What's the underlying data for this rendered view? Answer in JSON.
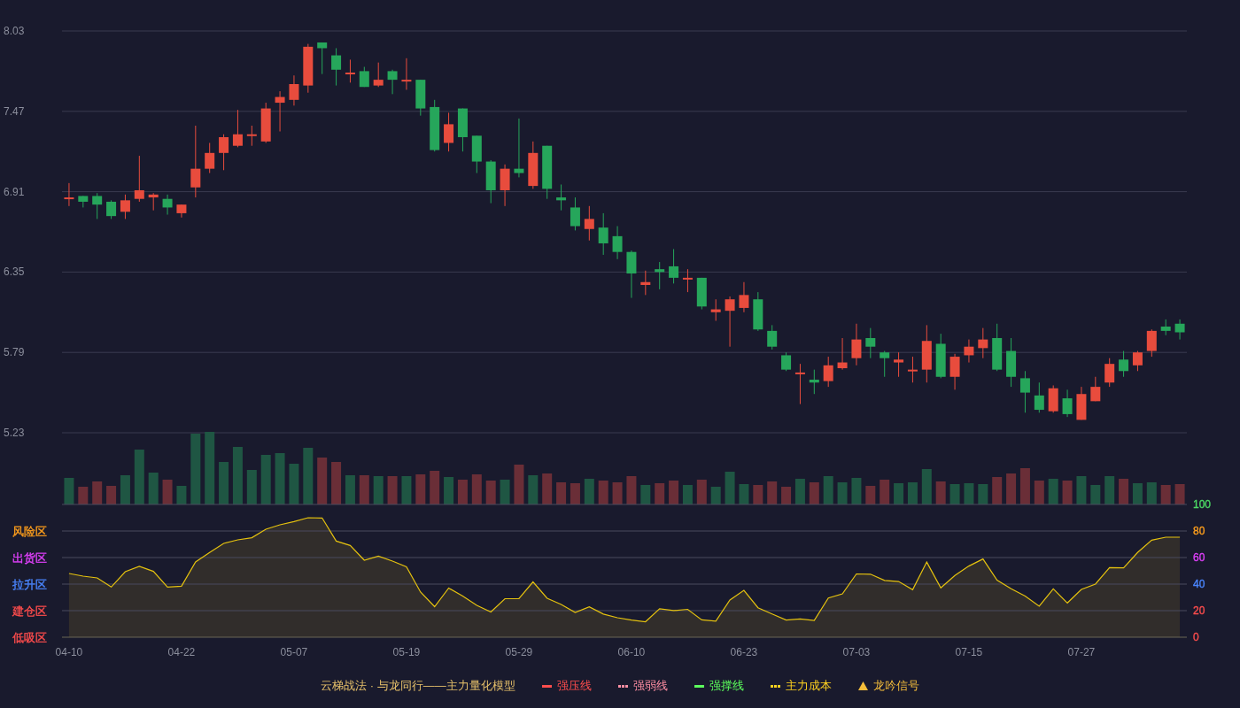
{
  "price_chart": {
    "chart_data": {
      "type": "candlestick",
      "categories": [
        null,
        null,
        null,
        null,
        null,
        null,
        null,
        null,
        null,
        null,
        null,
        null,
        null,
        null,
        null,
        null,
        null,
        null,
        null,
        null,
        null,
        null,
        null,
        null,
        null,
        null,
        null,
        null,
        null,
        null,
        null,
        null,
        null,
        null,
        null,
        null,
        null,
        null,
        null,
        null,
        null,
        null,
        null,
        null,
        null,
        null,
        null,
        null,
        null,
        null,
        null,
        null,
        null,
        null,
        null,
        null,
        null,
        null,
        null,
        null,
        null,
        null,
        null,
        null,
        null,
        null,
        null,
        null,
        null,
        null,
        null,
        null,
        null,
        null,
        null,
        null,
        null,
        null,
        null,
        null
      ],
      "ohlc": [
        [
          6.86,
          6.97,
          6.81,
          6.87
        ],
        [
          6.88,
          6.88,
          6.8,
          6.84
        ],
        [
          6.88,
          6.9,
          6.72,
          6.82
        ],
        [
          6.84,
          6.85,
          6.72,
          6.74
        ],
        [
          6.77,
          6.89,
          6.72,
          6.85
        ],
        [
          6.86,
          7.16,
          6.84,
          6.92
        ],
        [
          6.87,
          6.9,
          6.78,
          6.89
        ],
        [
          6.86,
          6.89,
          6.75,
          6.8
        ],
        [
          6.76,
          6.82,
          6.73,
          6.82
        ],
        [
          6.94,
          7.37,
          6.87,
          7.07
        ],
        [
          7.07,
          7.25,
          7.04,
          7.18
        ],
        [
          7.18,
          7.31,
          7.06,
          7.29
        ],
        [
          7.23,
          7.48,
          7.22,
          7.31
        ],
        [
          7.3,
          7.37,
          7.23,
          7.31
        ],
        [
          7.26,
          7.53,
          7.25,
          7.49
        ],
        [
          7.53,
          7.61,
          7.33,
          7.57
        ],
        [
          7.55,
          7.72,
          7.51,
          7.66
        ],
        [
          7.65,
          7.94,
          7.6,
          7.92
        ],
        [
          7.95,
          7.95,
          7.73,
          7.91
        ],
        [
          7.86,
          7.91,
          7.65,
          7.76
        ],
        [
          7.73,
          7.83,
          7.67,
          7.74
        ],
        [
          7.75,
          7.78,
          7.64,
          7.64
        ],
        [
          7.65,
          7.81,
          7.64,
          7.69
        ],
        [
          7.75,
          7.76,
          7.59,
          7.69
        ],
        [
          7.68,
          7.84,
          7.62,
          7.69
        ],
        [
          7.69,
          7.69,
          7.44,
          7.49
        ],
        [
          7.5,
          7.55,
          7.19,
          7.2
        ],
        [
          7.25,
          7.46,
          7.19,
          7.38
        ],
        [
          7.49,
          7.49,
          7.19,
          7.29
        ],
        [
          7.3,
          7.3,
          7.04,
          7.12
        ],
        [
          7.12,
          7.13,
          6.83,
          6.92
        ],
        [
          6.92,
          7.1,
          6.81,
          7.07
        ],
        [
          7.07,
          7.42,
          7.01,
          7.04
        ],
        [
          6.95,
          7.26,
          6.93,
          7.18
        ],
        [
          7.23,
          7.23,
          6.86,
          6.93
        ],
        [
          6.87,
          6.96,
          6.78,
          6.85
        ],
        [
          6.8,
          6.87,
          6.64,
          6.67
        ],
        [
          6.65,
          6.81,
          6.57,
          6.72
        ],
        [
          6.66,
          6.76,
          6.47,
          6.55
        ],
        [
          6.6,
          6.67,
          6.44,
          6.49
        ],
        [
          6.49,
          6.5,
          6.17,
          6.34
        ],
        [
          6.26,
          6.36,
          6.19,
          6.28
        ],
        [
          6.37,
          6.42,
          6.23,
          6.35
        ],
        [
          6.39,
          6.51,
          6.27,
          6.31
        ],
        [
          6.3,
          6.37,
          6.21,
          6.31
        ],
        [
          6.31,
          6.31,
          6.09,
          6.11
        ],
        [
          6.07,
          6.16,
          6.01,
          6.09
        ],
        [
          6.08,
          6.18,
          5.83,
          6.16
        ],
        [
          6.1,
          6.28,
          6.07,
          6.19
        ],
        [
          6.16,
          6.21,
          5.94,
          5.95
        ],
        [
          5.94,
          5.98,
          5.81,
          5.83
        ],
        [
          5.77,
          5.79,
          5.66,
          5.67
        ],
        [
          5.64,
          5.71,
          5.43,
          5.65
        ],
        [
          5.6,
          5.67,
          5.5,
          5.58
        ],
        [
          5.59,
          5.76,
          5.55,
          5.7
        ],
        [
          5.68,
          5.89,
          5.67,
          5.72
        ],
        [
          5.75,
          5.99,
          5.7,
          5.88
        ],
        [
          5.89,
          5.96,
          5.75,
          5.83
        ],
        [
          5.79,
          5.8,
          5.62,
          5.75
        ],
        [
          5.72,
          5.79,
          5.62,
          5.74
        ],
        [
          5.66,
          5.76,
          5.58,
          5.67
        ],
        [
          5.67,
          5.98,
          5.58,
          5.87
        ],
        [
          5.85,
          5.92,
          5.61,
          5.62
        ],
        [
          5.62,
          5.78,
          5.53,
          5.76
        ],
        [
          5.77,
          5.88,
          5.72,
          5.83
        ],
        [
          5.82,
          5.96,
          5.75,
          5.88
        ],
        [
          5.89,
          5.99,
          5.66,
          5.67
        ],
        [
          5.8,
          5.89,
          5.55,
          5.62
        ],
        [
          5.61,
          5.66,
          5.37,
          5.51
        ],
        [
          5.49,
          5.58,
          5.37,
          5.39
        ],
        [
          5.38,
          5.56,
          5.37,
          5.54
        ],
        [
          5.47,
          5.53,
          5.34,
          5.36
        ],
        [
          5.32,
          5.55,
          5.32,
          5.5
        ],
        [
          5.45,
          5.62,
          5.45,
          5.55
        ],
        [
          5.58,
          5.75,
          5.55,
          5.71
        ],
        [
          5.74,
          5.8,
          5.62,
          5.66
        ],
        [
          5.7,
          5.8,
          5.66,
          5.79
        ],
        [
          5.8,
          5.95,
          5.76,
          5.94
        ],
        [
          5.97,
          6.02,
          5.91,
          5.94
        ],
        [
          5.99,
          6.02,
          5.88,
          5.93
        ]
      ],
      "ylim": [
        5.23,
        8.03
      ],
      "yticks": [
        8.03,
        7.47,
        6.91,
        6.35,
        5.79,
        5.23
      ],
      "grid": true
    }
  },
  "indicator": {
    "zones": [
      {
        "label": "风险区",
        "color": "#ff9f1c"
      },
      {
        "label": "出货区",
        "color": "#e040fb"
      },
      {
        "label": "拉升区",
        "color": "#4a86ff"
      },
      {
        "label": "建仓区",
        "color": "#ff4d4d"
      },
      {
        "label": "低吸区",
        "color": "#ff4d4d"
      }
    ],
    "ytick_colors": [
      {
        "color": "#ff4d4d"
      },
      {
        "color": "#ff4d4d"
      },
      {
        "color": "#4a86ff"
      },
      {
        "color": "#e040fb"
      },
      {
        "color": "#ff9f1c"
      },
      {
        "color": "#4cd964"
      }
    ],
    "chart_data": {
      "type": "area",
      "categories": [
        "04-10",
        null,
        null,
        null,
        null,
        null,
        null,
        null,
        "04-22",
        null,
        null,
        null,
        null,
        null,
        null,
        null,
        "05-07",
        null,
        null,
        null,
        null,
        null,
        null,
        null,
        "05-19",
        null,
        null,
        null,
        null,
        null,
        null,
        null,
        "05-29",
        null,
        null,
        null,
        null,
        null,
        null,
        null,
        "06-10",
        null,
        null,
        null,
        null,
        null,
        null,
        null,
        "06-23",
        null,
        null,
        null,
        null,
        null,
        null,
        null,
        "07-03",
        null,
        null,
        null,
        null,
        null,
        null,
        null,
        "07-15",
        null,
        null,
        null,
        null,
        null,
        null,
        null,
        "07-27",
        null,
        null,
        null,
        null,
        null,
        null,
        null
      ],
      "series": [
        {
          "color": "#e5c20f",
          "values": [
            48,
            46,
            44.7,
            37.8,
            49.3,
            53.3,
            49.6,
            37.8,
            38.4,
            56.7,
            63.8,
            70.7,
            73.3,
            74.9,
            81.3,
            84.7,
            87.1,
            90,
            89.8,
            72.4,
            69.1,
            58,
            61.1,
            57.3,
            53,
            34,
            23,
            37,
            31,
            24,
            19,
            29,
            29,
            41.7,
            29.3,
            24.7,
            18.7,
            22.9,
            17.4,
            14.7,
            12.9,
            11.7,
            21.5,
            20.1,
            21,
            13.1,
            12.1,
            28.1,
            35.3,
            22.2,
            17.5,
            12.9,
            13.8,
            12.7,
            29.5,
            32.7,
            47.7,
            47.5,
            42.8,
            41.9,
            35.8,
            56.6,
            37.2,
            46.5,
            53.6,
            58.9,
            43,
            36.5,
            31,
            23.3,
            36.4,
            25.8,
            36,
            40,
            52.4,
            52.2,
            63.8,
            73.1,
            75.3,
            75.3
          ]
        }
      ],
      "ylim": [
        0,
        100
      ],
      "yticks": [
        0,
        20,
        40,
        60,
        80,
        100
      ],
      "grid": true
    }
  },
  "legend": {
    "title": "云梯战法 · 与龙同行——主力量化模型",
    "items": [
      {
        "label": "强压线",
        "kind": "solid",
        "color": "#ff4d4d"
      },
      {
        "label": "强弱线",
        "kind": "dashed",
        "color": "#ff8fa3"
      },
      {
        "label": "强撑线",
        "kind": "solid",
        "color": "#5cff5c"
      },
      {
        "label": "主力成本",
        "kind": "dashed",
        "color": "#ffd21f"
      },
      {
        "label": "龙吟信号",
        "kind": "triangle",
        "color": "#f5bd3a"
      }
    ]
  }
}
